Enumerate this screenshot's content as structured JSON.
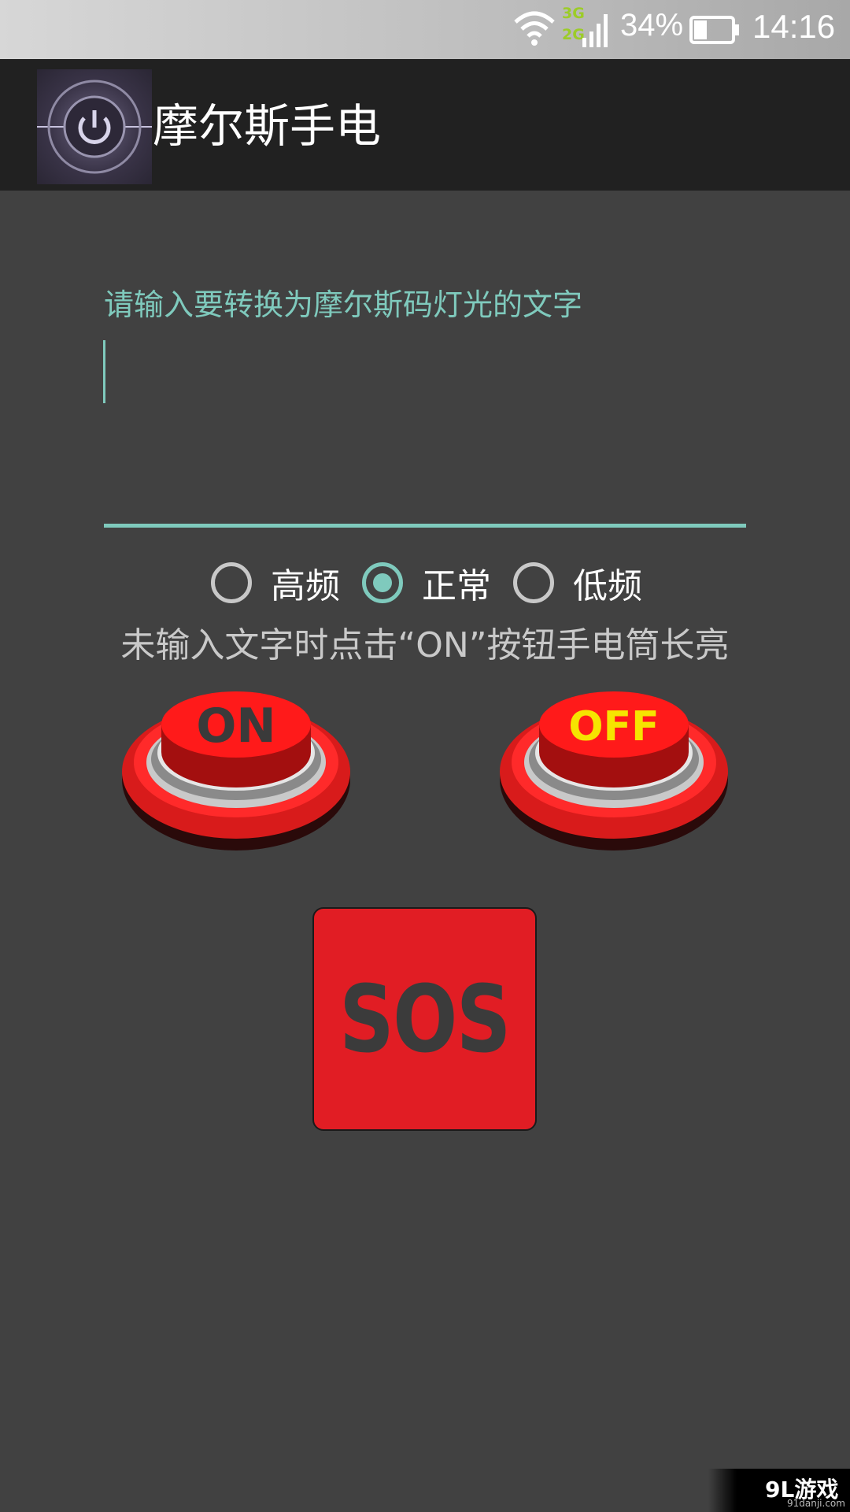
{
  "status_bar": {
    "network_top": "3G",
    "network_bottom": "2G",
    "battery_percent": "34%",
    "battery_level": 0.34,
    "time": "14:16"
  },
  "action_bar": {
    "title": "摩尔斯手电",
    "icon": "power-icon"
  },
  "input": {
    "placeholder": "请输入要转换为摩尔斯码灯光的文字",
    "value": ""
  },
  "frequency": {
    "options": [
      "高频",
      "正常",
      "低频"
    ],
    "selected": "正常"
  },
  "info_text": "未输入文字时点击“ON”按钮手电筒长亮",
  "buttons": {
    "on_label": "ON",
    "off_label": "OFF",
    "sos_label": "SOS"
  },
  "watermark": {
    "main": "9L游戏",
    "sub": "91danji.com"
  },
  "colors": {
    "accent": "#7fcabd",
    "button_red": "#e11d24",
    "off_text": "#f6e400",
    "background": "#414141"
  }
}
